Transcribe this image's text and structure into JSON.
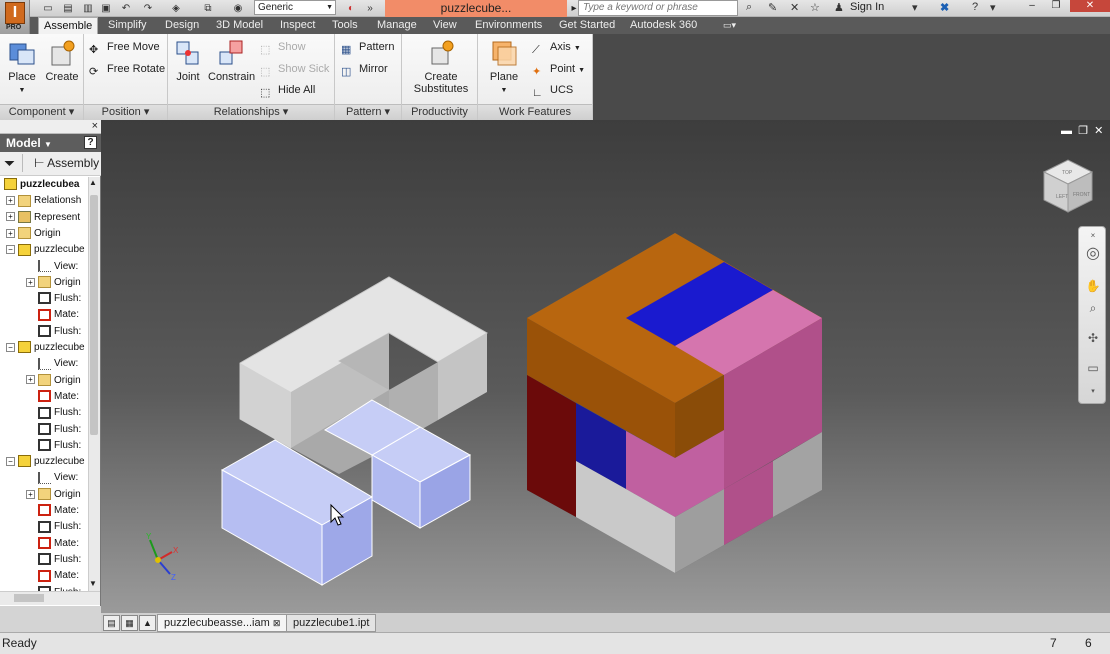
{
  "app": {
    "logo_letter": "I",
    "logo_badge": "PRO",
    "style_select": "Generic",
    "document_title": "puzzlecube...",
    "search_placeholder": "Type a keyword or phrase",
    "sign_in": "Sign In"
  },
  "ribbon_tabs": [
    "Assemble",
    "Simplify",
    "Design",
    "3D Model",
    "Inspect",
    "Tools",
    "Manage",
    "View",
    "Environments",
    "Get Started",
    "Autodesk 360"
  ],
  "ribbon": {
    "component": {
      "title": "Component",
      "place": "Place",
      "create": "Create"
    },
    "position": {
      "title": "Position",
      "free_move": "Free Move",
      "free_rotate": "Free Rotate"
    },
    "relationships": {
      "title": "Relationships",
      "joint": "Joint",
      "constrain": "Constrain",
      "show": "Show",
      "show_sick": "Show Sick",
      "hide_all": "Hide All"
    },
    "pattern": {
      "title": "Pattern",
      "pattern": "Pattern",
      "mirror": "Mirror"
    },
    "productivity": {
      "title": "Productivity",
      "create_substitutes_1": "Create",
      "create_substitutes_2": "Substitutes"
    },
    "work_features": {
      "title": "Work Features",
      "plane": "Plane",
      "axis": "Axis",
      "point": "Point",
      "ucs": "UCS"
    }
  },
  "browser": {
    "title": "Model",
    "assembly_label": "Assembly",
    "help_glyph": "?",
    "close_glyph": "×",
    "tree": [
      {
        "label": "puzzlecubea",
        "icon": "assembly-icon",
        "level": 0,
        "bold": true
      },
      {
        "label": "Relationsh",
        "icon": "folder-icon",
        "level": 1
      },
      {
        "label": "Represent",
        "icon": "representation-icon",
        "level": 1
      },
      {
        "label": "Origin",
        "icon": "folder-icon",
        "level": 1
      },
      {
        "label": "puzzlecube",
        "icon": "part-icon",
        "level": 1
      },
      {
        "label": "View:",
        "icon": "view-icon",
        "level": 2
      },
      {
        "label": "Origin",
        "icon": "folder-icon",
        "level": 2
      },
      {
        "label": "Flush:",
        "icon": "flush-icon",
        "level": 2
      },
      {
        "label": "Mate:",
        "icon": "mate-icon",
        "level": 2
      },
      {
        "label": "Flush:",
        "icon": "flush-icon",
        "level": 2
      },
      {
        "label": "puzzlecube",
        "icon": "part-icon",
        "level": 1
      },
      {
        "label": "View:",
        "icon": "view-icon",
        "level": 2
      },
      {
        "label": "Origin",
        "icon": "folder-icon",
        "level": 2
      },
      {
        "label": "Mate:",
        "icon": "mate-icon",
        "level": 2
      },
      {
        "label": "Flush:",
        "icon": "flush-icon",
        "level": 2
      },
      {
        "label": "Flush:",
        "icon": "flush-icon",
        "level": 2
      },
      {
        "label": "Flush:",
        "icon": "flush-icon",
        "level": 2
      },
      {
        "label": "puzzlecube",
        "icon": "part-icon",
        "level": 1
      },
      {
        "label": "View:",
        "icon": "view-icon",
        "level": 2
      },
      {
        "label": "Origin",
        "icon": "folder-icon",
        "level": 2
      },
      {
        "label": "Mate:",
        "icon": "mate-icon",
        "level": 2
      },
      {
        "label": "Flush:",
        "icon": "flush-icon",
        "level": 2
      },
      {
        "label": "Mate:",
        "icon": "mate-icon",
        "level": 2
      },
      {
        "label": "Flush:",
        "icon": "flush-icon",
        "level": 2
      },
      {
        "label": "Mate:",
        "icon": "mate-icon",
        "level": 2
      },
      {
        "label": "Flush:",
        "icon": "flush-icon",
        "level": 2
      }
    ]
  },
  "view_cube": {
    "face_top": "TOP",
    "face_left": "LEFT",
    "face_front": "FRONT"
  },
  "triad": {
    "x": "X",
    "y": "Y",
    "z": "Z"
  },
  "doc_tabs": [
    "puzzlecubeasse...iam",
    "puzzlecube1.ipt"
  ],
  "status": {
    "text": "Ready",
    "count_a": "7",
    "count_b": "6"
  },
  "colors": {
    "orange": "#b8660f",
    "blue": "#1a1acf",
    "pink": "#c966a0",
    "dark_red": "#6b0a0a",
    "gray": "#bdbdbd",
    "selected_blue": "#aab4f0"
  }
}
